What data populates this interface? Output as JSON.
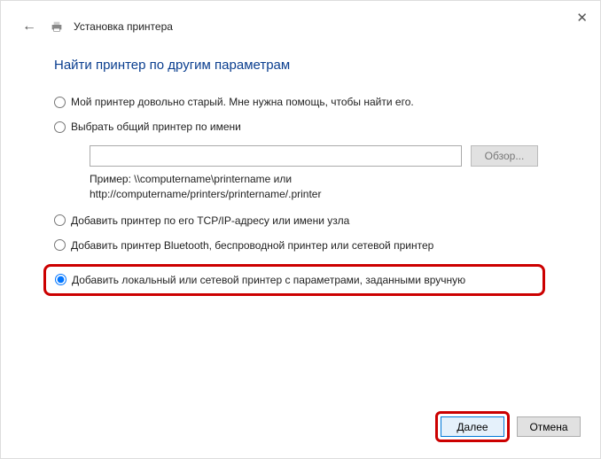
{
  "header": {
    "title": "Установка принтера"
  },
  "heading": "Найти принтер по другим параметрам",
  "options": {
    "old": "Мой принтер довольно старый. Мне нужна помощь, чтобы найти его.",
    "shared": "Выбрать общий принтер по имени",
    "browse": "Обзор...",
    "exampleLine1": "Пример: \\\\computername\\printername или",
    "exampleLine2": "http://computername/printers/printername/.printer",
    "tcpip": "Добавить принтер по его TCP/IP-адресу или имени узла",
    "bluetooth": "Добавить принтер Bluetooth, беспроводной принтер или сетевой принтер",
    "manual": "Добавить локальный или сетевой принтер с параметрами, заданными вручную"
  },
  "nameInput": {
    "value": ""
  },
  "footer": {
    "next": "Далее",
    "cancel": "Отмена"
  }
}
